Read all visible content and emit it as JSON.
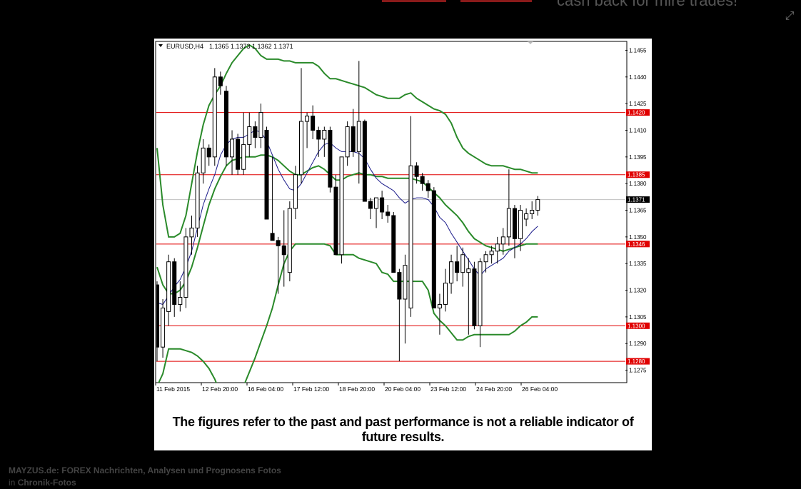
{
  "header": {
    "faded_text": "cash back for mire trades!"
  },
  "lightbox": {
    "expand_icon": "expand-icon"
  },
  "chart_data": {
    "type": "candlestick",
    "symbol_label": "EURUSD,H4",
    "ohlc_label": "1.1365 1.1373 1.1362 1.1371",
    "price_axis": {
      "ylim": [
        1.1268,
        1.146
      ],
      "ticks": [
        "1.1455",
        "1.1440",
        "1.1425",
        "1.1410",
        "1.1395",
        "1.1380",
        "1.1365",
        "1.1350",
        "1.1335",
        "1.1320",
        "1.1305",
        "1.1290",
        "1.1275"
      ]
    },
    "time_axis_labels": [
      "11 Feb 2015",
      "12 Feb 20:00",
      "16 Feb 04:00",
      "17 Feb 12:00",
      "18 Feb 20:00",
      "20 Feb 04:00",
      "23 Feb 12:00",
      "24 Feb 20:00",
      "26 Feb 04:00"
    ],
    "current_price": "1.1371",
    "horizontal_levels": [
      {
        "label": "1.1420",
        "value": 1.142
      },
      {
        "label": "1.1385",
        "value": 1.1385
      },
      {
        "label": "1.1346",
        "value": 1.1346
      },
      {
        "label": "1.1300",
        "value": 1.13
      },
      {
        "label": "1.1280",
        "value": 1.128
      }
    ],
    "candles": [
      [
        1.1323,
        1.1325,
        1.128,
        1.1288
      ],
      [
        1.1288,
        1.1315,
        1.1282,
        1.131
      ],
      [
        1.1308,
        1.134,
        1.13,
        1.1336
      ],
      [
        1.1336,
        1.1338,
        1.1305,
        1.1312
      ],
      [
        1.1312,
        1.1325,
        1.1308,
        1.1316
      ],
      [
        1.1316,
        1.1355,
        1.131,
        1.135
      ],
      [
        1.135,
        1.1362,
        1.134,
        1.1355
      ],
      [
        1.1355,
        1.139,
        1.135,
        1.1386
      ],
      [
        1.1386,
        1.1405,
        1.138,
        1.14
      ],
      [
        1.14,
        1.1402,
        1.139,
        1.1395
      ],
      [
        1.1395,
        1.1445,
        1.139,
        1.144
      ],
      [
        1.144,
        1.1443,
        1.143,
        1.1435
      ],
      [
        1.1432,
        1.1435,
        1.139,
        1.1395
      ],
      [
        1.1395,
        1.141,
        1.1385,
        1.1405
      ],
      [
        1.1405,
        1.1408,
        1.1385,
        1.1388
      ],
      [
        1.1388,
        1.142,
        1.1385,
        1.1402
      ],
      [
        1.1402,
        1.142,
        1.1395,
        1.1412
      ],
      [
        1.1412,
        1.1415,
        1.14,
        1.1406
      ],
      [
        1.1406,
        1.1425,
        1.14,
        1.142
      ],
      [
        1.141,
        1.1412,
        1.136,
        1.136
      ],
      [
        1.1352,
        1.1395,
        1.135,
        1.1348
      ],
      [
        1.1348,
        1.135,
        1.1318,
        1.1345
      ],
      [
        1.1345,
        1.1365,
        1.1322,
        1.134
      ],
      [
        1.133,
        1.137,
        1.1325,
        1.1366
      ],
      [
        1.1366,
        1.139,
        1.136,
        1.1385
      ],
      [
        1.1385,
        1.1445,
        1.138,
        1.1415
      ],
      [
        1.1415,
        1.142,
        1.14,
        1.1418
      ],
      [
        1.1418,
        1.1424,
        1.1405,
        1.141
      ],
      [
        1.141,
        1.1412,
        1.1395,
        1.1405
      ],
      [
        1.1405,
        1.1412,
        1.1395,
        1.141
      ],
      [
        1.141,
        1.1412,
        1.1375,
        1.1378
      ],
      [
        1.1378,
        1.1385,
        1.134,
        1.134
      ],
      [
        1.134,
        1.135,
        1.1335,
        1.1395
      ],
      [
        1.1395,
        1.1415,
        1.139,
        1.1412
      ],
      [
        1.1412,
        1.1422,
        1.1395,
        1.1398
      ],
      [
        1.1398,
        1.1449,
        1.138,
        1.1415
      ],
      [
        1.1415,
        1.1416,
        1.137,
        1.137
      ],
      [
        1.137,
        1.1372,
        1.136,
        1.1366
      ],
      [
        1.1366,
        1.1372,
        1.1355,
        1.1372
      ],
      [
        1.1372,
        1.1376,
        1.136,
        1.1364
      ],
      [
        1.1364,
        1.1368,
        1.1358,
        1.1362
      ],
      [
        1.1362,
        1.1364,
        1.133,
        1.133
      ],
      [
        1.133,
        1.1332,
        1.128,
        1.1315
      ],
      [
        1.1315,
        1.134,
        1.129,
        1.1334
      ],
      [
        1.131,
        1.1418,
        1.1305,
        1.139
      ],
      [
        1.139,
        1.1392,
        1.138,
        1.1384
      ],
      [
        1.1384,
        1.1386,
        1.1376,
        1.138
      ],
      [
        1.138,
        1.1382,
        1.1372,
        1.1376
      ],
      [
        1.1376,
        1.1378,
        1.131,
        1.131
      ],
      [
        1.131,
        1.1318,
        1.1295,
        1.1312
      ],
      [
        1.1312,
        1.1332,
        1.1308,
        1.1324
      ],
      [
        1.1324,
        1.134,
        1.1318,
        1.1336
      ],
      [
        1.1336,
        1.1345,
        1.1325,
        1.133
      ],
      [
        1.133,
        1.1344,
        1.1322,
        1.134
      ],
      [
        1.133,
        1.1338,
        1.1295,
        1.1332
      ],
      [
        1.1332,
        1.1336,
        1.1298,
        1.13
      ],
      [
        1.13,
        1.1338,
        1.1288,
        1.1336
      ],
      [
        1.1336,
        1.1342,
        1.133,
        1.134
      ],
      [
        1.134,
        1.1345,
        1.1335,
        1.1342
      ],
      [
        1.1342,
        1.135,
        1.1335,
        1.1346
      ],
      [
        1.1346,
        1.1355,
        1.134,
        1.135
      ],
      [
        1.135,
        1.1388,
        1.1345,
        1.1366
      ],
      [
        1.1366,
        1.1368,
        1.1338,
        1.1349
      ],
      [
        1.1349,
        1.1368,
        1.1342,
        1.1365
      ],
      [
        1.136,
        1.1366,
        1.1356,
        1.1363
      ],
      [
        1.1363,
        1.137,
        1.136,
        1.1365
      ],
      [
        1.1365,
        1.1373,
        1.1362,
        1.1371
      ]
    ],
    "indicators": [
      {
        "name": "",
        "color": "#2a8a2a",
        "x": [
          0,
          1,
          2,
          3,
          4,
          5,
          6,
          7,
          8,
          9,
          10,
          11,
          12,
          13,
          14,
          15,
          16,
          17,
          18,
          19,
          20,
          21,
          22,
          23,
          24,
          25,
          26,
          27,
          28,
          29,
          30,
          31,
          32,
          33,
          34,
          35,
          36,
          37,
          38,
          39,
          40,
          41,
          42,
          43,
          44,
          45,
          46,
          47,
          48,
          49,
          50,
          51,
          52,
          53,
          54,
          55,
          56,
          57,
          58,
          59,
          60,
          61,
          62,
          63,
          64,
          65,
          66
        ],
        "upper": [
          1.14,
          1.1368,
          1.135,
          1.135,
          1.1352,
          1.1362,
          1.138,
          1.1398,
          1.1413,
          1.1424,
          1.143,
          1.1435,
          1.1442,
          1.1448,
          1.1452,
          1.1456,
          1.1458,
          1.1456,
          1.1452,
          1.145,
          1.145,
          1.145,
          1.1449,
          1.1449,
          1.1448,
          1.1448,
          1.1448,
          1.1448,
          1.1446,
          1.1442,
          1.1439,
          1.1439,
          1.1438,
          1.1437,
          1.1436,
          1.1435,
          1.1434,
          1.1432,
          1.143,
          1.1429,
          1.1428,
          1.1428,
          1.1428,
          1.143,
          1.1431,
          1.1428,
          1.1426,
          1.1424,
          1.1422,
          1.1421,
          1.1419,
          1.1414,
          1.1406,
          1.14,
          1.1397,
          1.1395,
          1.1393,
          1.1391,
          1.139,
          1.139,
          1.139,
          1.1389,
          1.1388,
          1.1388,
          1.1387,
          1.1386,
          1.1386
        ],
        "middle": [
          1.1333,
          1.1323,
          1.1318,
          1.1318,
          1.132,
          1.1325,
          1.1333,
          1.1344,
          1.1356,
          1.1368,
          1.1377,
          1.1384,
          1.139,
          1.1393,
          1.1394,
          1.1395,
          1.1395,
          1.1395,
          1.1396,
          1.1396,
          1.1395,
          1.1393,
          1.139,
          1.1387,
          1.1385,
          1.1385,
          1.1387,
          1.1389,
          1.139,
          1.1388,
          1.1385,
          1.1382,
          1.1382,
          1.1384,
          1.1385,
          1.1386,
          1.1385,
          1.1385,
          1.1384,
          1.1384,
          1.1383,
          1.1383,
          1.1383,
          1.1383,
          1.1383,
          1.1382,
          1.1381,
          1.1378,
          1.1375,
          1.1372,
          1.1368,
          1.1365,
          1.1362,
          1.1358,
          1.1353,
          1.1349,
          1.1347,
          1.1345,
          1.1344,
          1.1343,
          1.1342,
          1.1343,
          1.1344,
          1.1345,
          1.1346,
          1.1346,
          1.1346
        ],
        "lower": [
          1.1266,
          1.1273,
          1.1287,
          1.1287,
          1.1287,
          1.1286,
          1.1285,
          1.1283,
          1.128,
          1.1276,
          1.127,
          1.1262,
          1.1258,
          1.1256,
          1.1259,
          1.1266,
          1.1274,
          1.1282,
          1.1291,
          1.13,
          1.131,
          1.1323,
          1.1335,
          1.1342,
          1.1346,
          1.1346,
          1.1346,
          1.1346,
          1.1346,
          1.1346,
          1.1345,
          1.134,
          1.134,
          1.134,
          1.134,
          1.1338,
          1.1337,
          1.1336,
          1.1335,
          1.133,
          1.1329,
          1.1325,
          1.1325,
          1.1325,
          1.1325,
          1.1325,
          1.1325,
          1.132,
          1.1307,
          1.1303,
          1.13,
          1.1296,
          1.1292,
          1.1292,
          1.1294,
          1.1295,
          1.1295,
          1.1295,
          1.1295,
          1.1295,
          1.1295,
          1.1295,
          1.1297,
          1.13,
          1.1302,
          1.1305,
          1.1305
        ]
      },
      {
        "name": "",
        "color": "#1a1a8a",
        "values": [
          1.1313,
          1.1312,
          1.1317,
          1.1322,
          1.1326,
          1.1333,
          1.1342,
          1.1355,
          1.1368,
          1.1377,
          1.1385,
          1.1396,
          1.1402,
          1.1405,
          1.1406,
          1.1406,
          1.1408,
          1.141,
          1.1409,
          1.1404,
          1.1396,
          1.1388,
          1.1382,
          1.1377,
          1.1376,
          1.138,
          1.1386,
          1.1392,
          1.1398,
          1.1402,
          1.1403,
          1.14,
          1.1398,
          1.1398,
          1.1398,
          1.1397,
          1.1394,
          1.1388,
          1.1383,
          1.138,
          1.1378,
          1.1376,
          1.1372,
          1.1369,
          1.1371,
          1.1372,
          1.1372,
          1.1371,
          1.1367,
          1.1361,
          1.1358,
          1.1352,
          1.1347,
          1.1342,
          1.1337,
          1.1332,
          1.1328,
          1.1332,
          1.1334,
          1.1336,
          1.1338,
          1.1342,
          1.1344,
          1.1346,
          1.1349,
          1.1353,
          1.1356
        ]
      }
    ]
  },
  "disclaimer": "The figures refer to the past and past performance is not a reliable indicator of future results.",
  "caption": {
    "title": "MAYZUS.de: FOREX Nachrichten, Analysen und Prognosens Fotos",
    "in_prefix": "in",
    "link": "Chronik-Fotos"
  }
}
